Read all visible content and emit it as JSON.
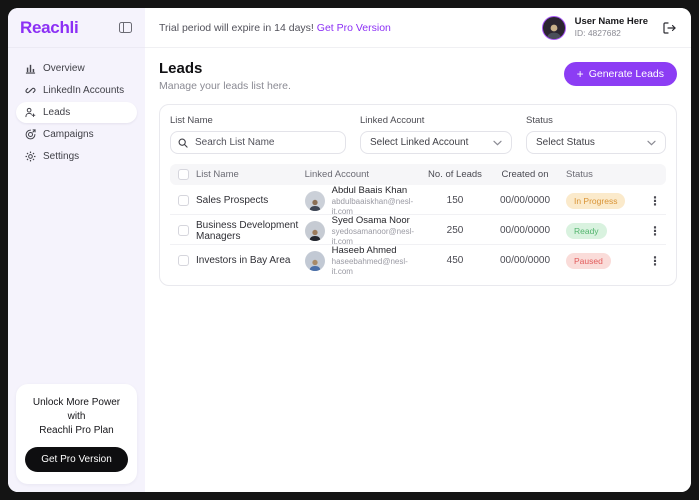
{
  "app": {
    "brand": "Reachli",
    "accent_color": "#8C30F5",
    "button_purple": "#8C3DF4",
    "sidebar_bg": "#F5F3FC",
    "frame_bg": "#141414"
  },
  "topbar": {
    "trial_text": "Trial period will expire in 14 days!",
    "trial_link": "Get Pro Version",
    "user": {
      "name": "User Name Here",
      "id": "ID: 4827682"
    },
    "logout_icon": "logout-icon"
  },
  "sidebar": {
    "items": [
      {
        "label": "Overview",
        "icon": "bar-chart-icon",
        "active": false
      },
      {
        "label": "LinkedIn Accounts",
        "icon": "link-icon",
        "active": false
      },
      {
        "label": "Leads",
        "icon": "person-add-icon",
        "active": true
      },
      {
        "label": "Campaigns",
        "icon": "campaign-icon",
        "active": false
      },
      {
        "label": "Settings",
        "icon": "gear-icon",
        "active": false
      }
    ],
    "promo": {
      "text_line1": "Unlock More Power with",
      "text_line2": "Reachli Pro Plan",
      "button_label": "Get Pro Version"
    }
  },
  "page": {
    "title": "Leads",
    "subtitle": "Manage your leads list here.",
    "generate_button_label": "Generate Leads",
    "generate_button_plus": "+"
  },
  "filters": {
    "list_name": {
      "label": "List Name",
      "placeholder": "Search List Name",
      "icon": "search-icon"
    },
    "linked_account": {
      "label": "Linked Account",
      "selected_value": "Select Linked Account"
    },
    "status": {
      "label": "Status",
      "selected_value": "Select Status"
    }
  },
  "table": {
    "columns": {
      "list_name": "List Name",
      "linked_account": "Linked Account",
      "no_of_leads": "No. of Leads",
      "created_on": "Created on",
      "status": "Status"
    },
    "rows": [
      {
        "list_name": "Sales Prospects",
        "account_name": "Abdul Baais Khan",
        "account_email": "abdulbaaiskhan@nesl-it.com",
        "leads": "150",
        "created": "00/00/0000",
        "status": "In Progress",
        "status_key": "in_progress"
      },
      {
        "list_name": "Business Development Managers",
        "account_name": "Syed Osama Noor",
        "account_email": "syedosamanoor@nesl-it.com",
        "leads": "250",
        "created": "00/00/0000",
        "status": "Ready",
        "status_key": "ready"
      },
      {
        "list_name": "Investors in Bay Area",
        "account_name": "Haseeb Ahmed",
        "account_email": "haseebahmed@nesl-it.com",
        "leads": "450",
        "created": "00/00/0000",
        "status": "Paused",
        "status_key": "paused"
      }
    ],
    "status_colors": {
      "in_progress": {
        "bg": "#FBEACB",
        "fg": "#D99437"
      },
      "ready": {
        "bg": "#D9F2DF",
        "fg": "#54B56F"
      },
      "paused": {
        "bg": "#FADCD9",
        "fg": "#E25C5C"
      }
    },
    "kebab_glyph": "⋮"
  }
}
